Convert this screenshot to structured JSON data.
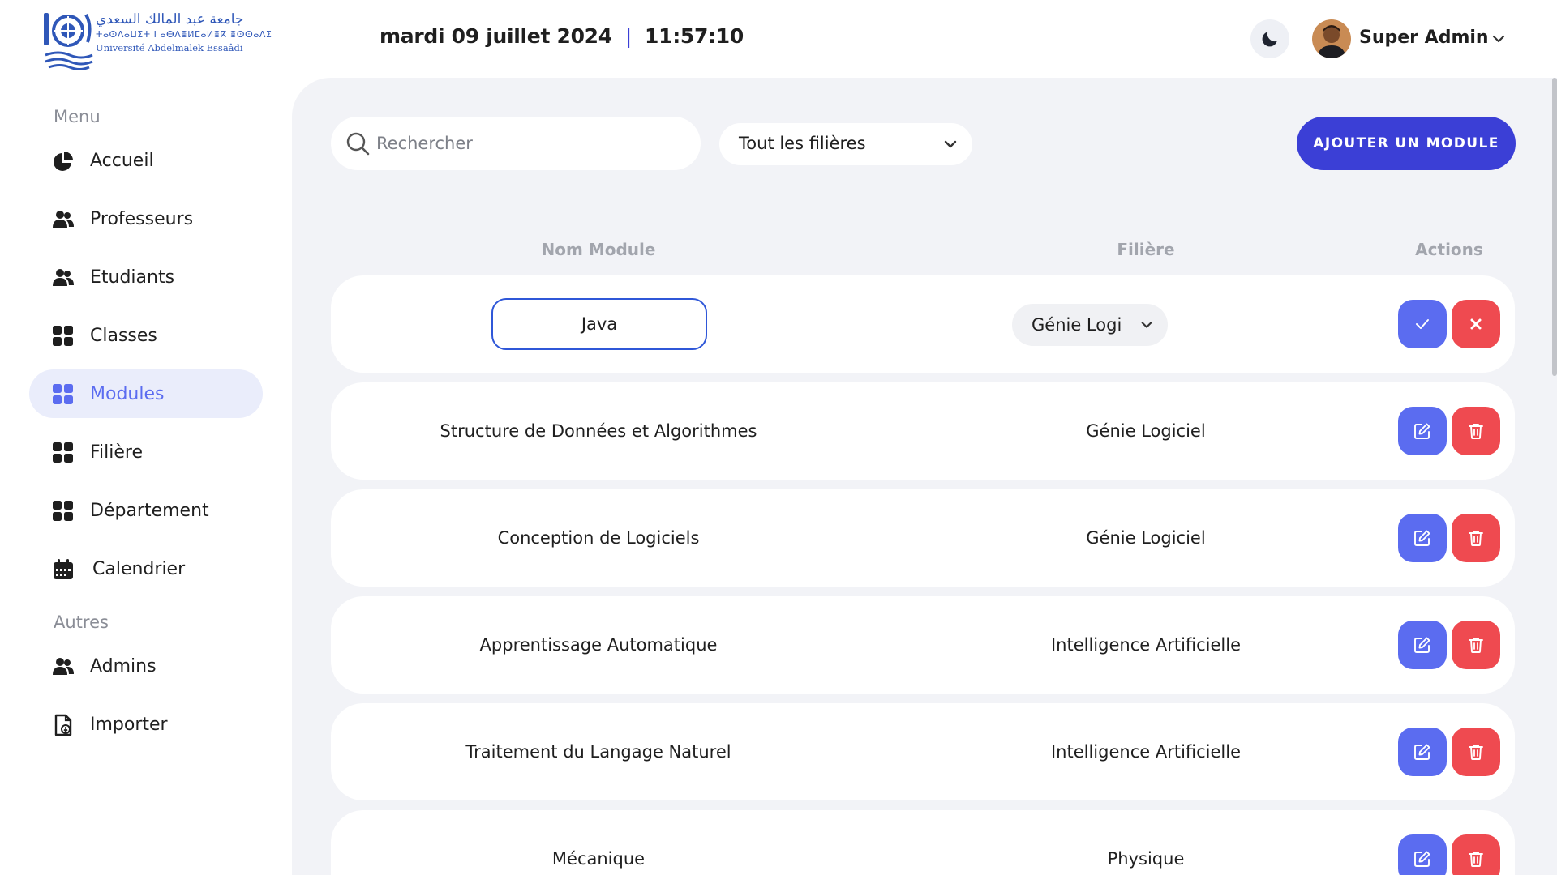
{
  "logo": {
    "arabic": "جامعة عبد المالك السعدي",
    "tifinagh": "ⵜⴰⵙⴷⴰⵡⵉⵜ Ⅰ ⴰⴱⴷⴻⵍⵎⴰⵍⴻⴽ ⴻⵙⵙⴰⴷⵉ",
    "french": "Université Abdelmalek Essaâdi"
  },
  "header": {
    "date": "mardi 09 juillet 2024",
    "separator": "|",
    "time": "11:57:10",
    "username": "Super Admin",
    "theme_icon": "moon-icon"
  },
  "sidebar": {
    "menu_title": "Menu",
    "other_title": "Autres",
    "items": [
      {
        "label": "Accueil",
        "icon": "pie-chart-icon"
      },
      {
        "label": "Professeurs",
        "icon": "users-icon"
      },
      {
        "label": "Etudiants",
        "icon": "users-icon"
      },
      {
        "label": "Classes",
        "icon": "grid-icon"
      },
      {
        "label": "Modules",
        "icon": "grid-icon",
        "active": true
      },
      {
        "label": "Filière",
        "icon": "grid-icon"
      },
      {
        "label": "Département",
        "icon": "grid-icon"
      },
      {
        "label": "Calendrier",
        "icon": "calendar-icon"
      }
    ],
    "other_items": [
      {
        "label": "Admins",
        "icon": "users-icon"
      },
      {
        "label": "Importer",
        "icon": "file-import-icon"
      }
    ]
  },
  "toolbar": {
    "search_placeholder": "Rechercher",
    "filter_value": "Tout les filières",
    "add_label": "AJOUTER UN MODULE"
  },
  "table": {
    "headers": {
      "name": "Nom Module",
      "filiere": "Filière",
      "actions": "Actions"
    },
    "editing_row": {
      "name": "Java",
      "filiere": "Génie Logi"
    },
    "rows": [
      {
        "name": "Structure de Données et Algorithmes",
        "filiere": "Génie Logiciel"
      },
      {
        "name": "Conception de Logiciels",
        "filiere": "Génie Logiciel"
      },
      {
        "name": "Apprentissage Automatique",
        "filiere": "Intelligence Artificielle"
      },
      {
        "name": "Traitement du Langage Naturel",
        "filiere": "Intelligence Artificielle"
      },
      {
        "name": "Mécanique",
        "filiere": "Physique"
      }
    ]
  },
  "colors": {
    "accent": "#3b3fd6",
    "action_blue": "#5b6cf0",
    "action_red": "#ef4a50",
    "main_bg": "#f2f3f7",
    "active_nav_bg": "#eaedfb"
  }
}
